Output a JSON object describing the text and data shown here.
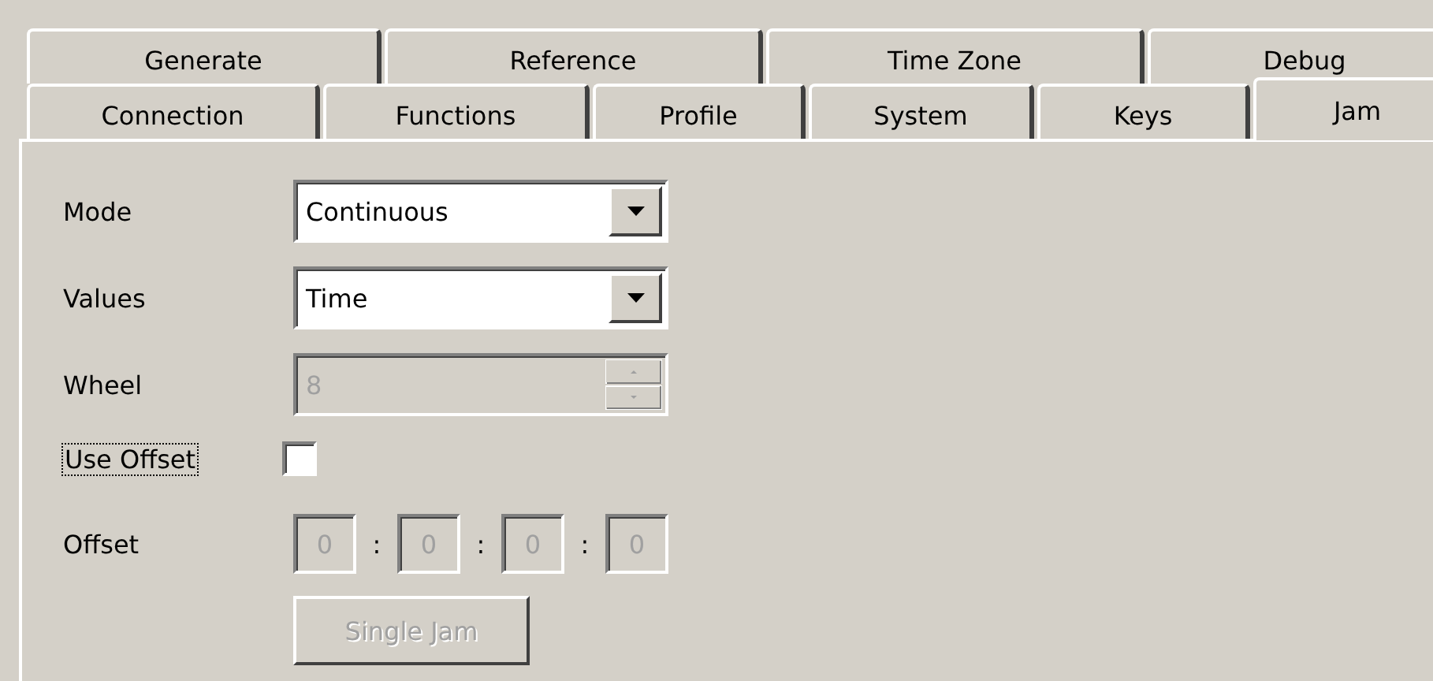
{
  "tab_rows": [
    [
      {
        "label": "Generate",
        "selected": false
      },
      {
        "label": "Reference",
        "selected": false
      },
      {
        "label": "Time Zone",
        "selected": false
      },
      {
        "label": "Debug",
        "selected": false
      }
    ],
    [
      {
        "label": "Connection",
        "selected": false
      },
      {
        "label": "Functions",
        "selected": false
      },
      {
        "label": "Profile",
        "selected": false
      },
      {
        "label": "System",
        "selected": false
      },
      {
        "label": "Keys",
        "selected": false
      },
      {
        "label": "Jam",
        "selected": true
      }
    ]
  ],
  "mode": {
    "label": "Mode",
    "value": "Continuous"
  },
  "values": {
    "label": "Values",
    "value": "Time"
  },
  "wheel": {
    "label": "Wheel",
    "value": "8",
    "disabled": true
  },
  "use_offset": {
    "label": "Use Offset",
    "checked": false,
    "focused": true
  },
  "offset": {
    "label": "Offset",
    "separator": ":",
    "fields": [
      "0",
      "0",
      "0",
      "0"
    ],
    "disabled": true
  },
  "single_jam": {
    "label": "Single Jam",
    "disabled": true
  }
}
